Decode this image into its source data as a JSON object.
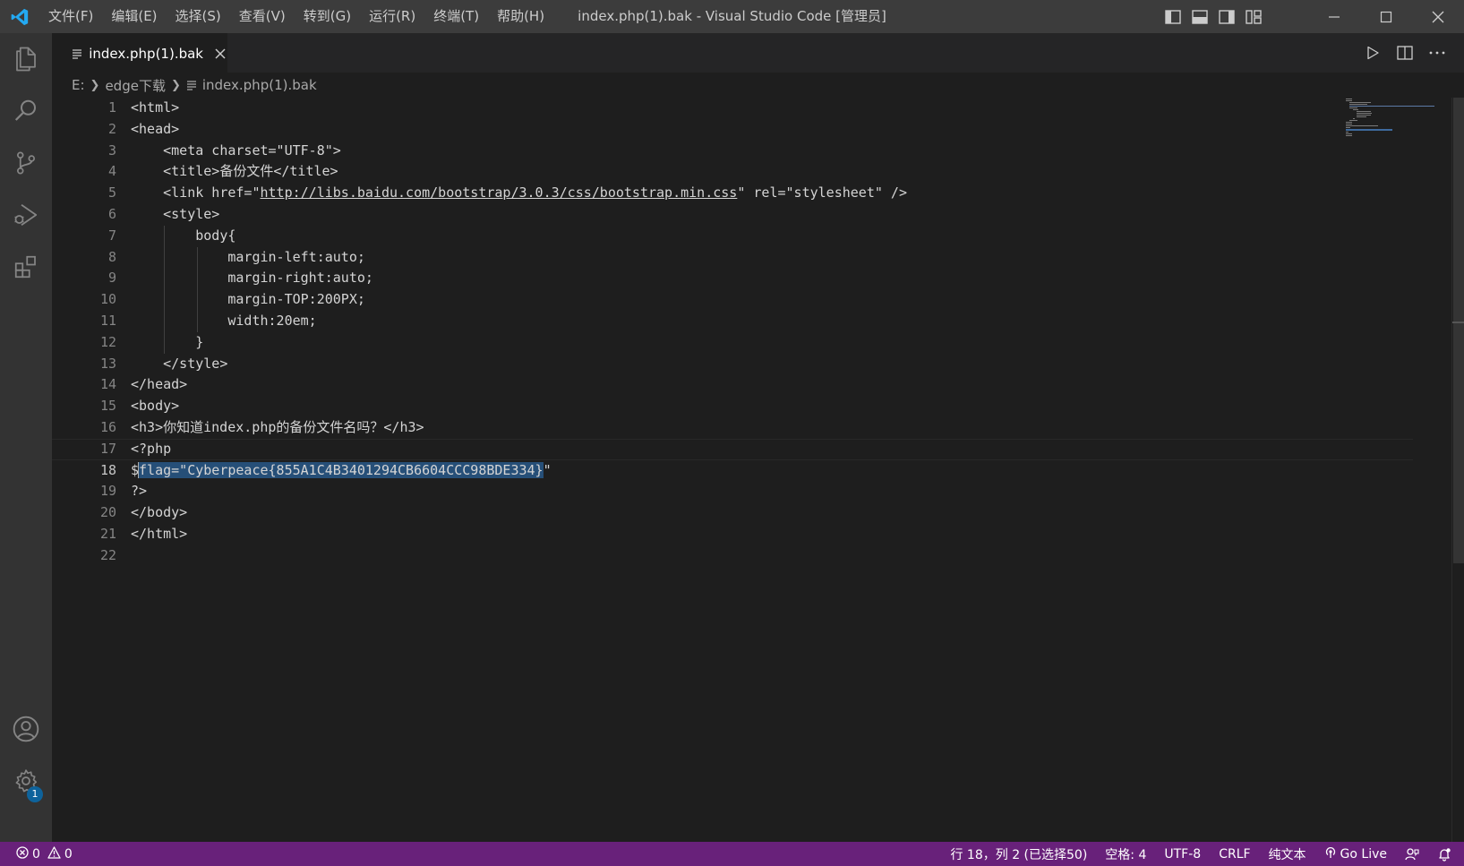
{
  "titlebar": {
    "menus": [
      "文件(F)",
      "编辑(E)",
      "选择(S)",
      "查看(V)",
      "转到(G)",
      "运行(R)",
      "终端(T)",
      "帮助(H)"
    ],
    "window_title": "index.php(1).bak - Visual Studio Code [管理员]"
  },
  "activity_bar": {
    "icons": [
      "explorer-icon",
      "search-icon",
      "source-control-icon",
      "run-debug-icon",
      "extensions-icon",
      "account-icon",
      "settings-gear-icon"
    ],
    "settings_badge": "1"
  },
  "tab": {
    "label": "index.php(1).bak"
  },
  "breadcrumb": {
    "drive": "E:",
    "folder": "edge下载",
    "file": "index.php(1).bak"
  },
  "editor": {
    "active_line": 18,
    "lines": [
      "<html>",
      "<head>",
      "    <meta charset=\"UTF-8\">",
      "    <title>备份文件</title>",
      "    <link href=\"",
      "    <style>",
      "        body{",
      "            margin-left:auto;",
      "            margin-right:auto;",
      "            margin-TOP:200PX;",
      "            width:20em;",
      "        }",
      "    </style>",
      "</head>",
      "<body>",
      "<h3>你知道index.php的备份文件名吗？</h3>",
      "<?php",
      "$",
      "?>",
      "</body>",
      "</html>",
      ""
    ],
    "line5_url": "http://libs.baidu.com/bootstrap/3.0.3/css/bootstrap.min.css",
    "line5_tail": "\" rel=\"stylesheet\" />",
    "line18_selected": "flag=\"Cyberpeace{855A1C4B3401294CB6604CCC98BDE334}",
    "line18_tail": "\""
  },
  "statusbar": {
    "errors": "0",
    "warnings": "0",
    "position": "行 18，列 2 (已选择50)",
    "spaces": "空格: 4",
    "encoding": "UTF-8",
    "eol": "CRLF",
    "language": "纯文本",
    "go_live": "Go Live"
  },
  "colors": {
    "statusbar_bg": "#68217a",
    "editor_bg": "#1e1e1e",
    "selection": "#264f78",
    "vscode_blue": "#23a9f2"
  }
}
